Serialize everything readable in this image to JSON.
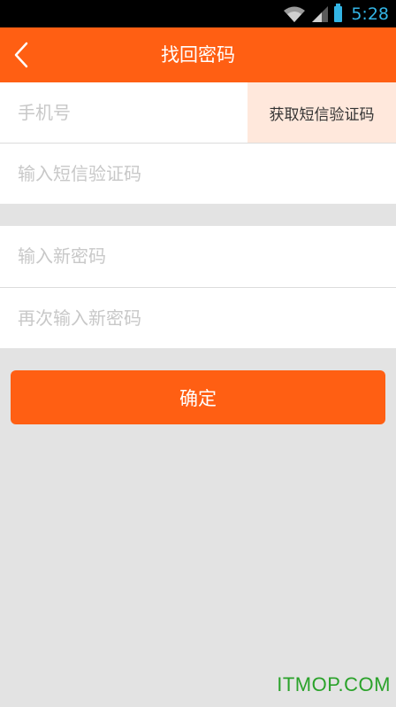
{
  "status_bar": {
    "time": "5:28"
  },
  "header": {
    "title": "找回密码"
  },
  "form": {
    "phone_placeholder": "手机号",
    "get_code_label": "获取短信验证码",
    "code_placeholder": "输入短信验证码",
    "new_password_placeholder": "输入新密码",
    "confirm_password_placeholder": "再次输入新密码",
    "submit_label": "确定"
  },
  "watermark": "ITMOP.COM",
  "colors": {
    "accent": "#ff5f13",
    "status_icon": "#33b5e5",
    "page_bg": "#e3e3e3",
    "sms_button_bg": "#ffe8dc",
    "watermark": "#2aa22a"
  }
}
